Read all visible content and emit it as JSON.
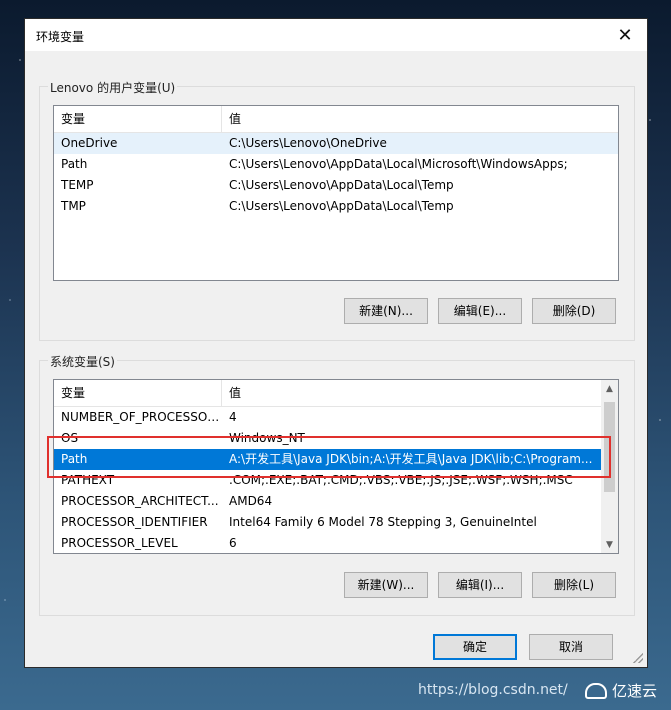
{
  "window": {
    "title": "环境变量",
    "close_glyph": "✕"
  },
  "user_vars": {
    "group_label": "Lenovo 的用户变量(U)",
    "columns": [
      "变量",
      "值"
    ],
    "rows": [
      {
        "name": "OneDrive",
        "value": "C:\\Users\\Lenovo\\OneDrive"
      },
      {
        "name": "Path",
        "value": "C:\\Users\\Lenovo\\AppData\\Local\\Microsoft\\WindowsApps;"
      },
      {
        "name": "TEMP",
        "value": "C:\\Users\\Lenovo\\AppData\\Local\\Temp"
      },
      {
        "name": "TMP",
        "value": "C:\\Users\\Lenovo\\AppData\\Local\\Temp"
      }
    ],
    "buttons": {
      "new": "新建(N)...",
      "edit": "编辑(E)...",
      "delete": "删除(D)"
    }
  },
  "system_vars": {
    "group_label": "系统变量(S)",
    "columns": [
      "变量",
      "值"
    ],
    "rows": [
      {
        "name": "NUMBER_OF_PROCESSORS",
        "value": "4"
      },
      {
        "name": "OS",
        "value": "Windows_NT"
      },
      {
        "name": "Path",
        "value": "A:\\开发工具\\Java JDK\\bin;A:\\开发工具\\Java JDK\\lib;C:\\Program..."
      },
      {
        "name": "PATHEXT",
        "value": ".COM;.EXE;.BAT;.CMD;.VBS;.VBE;.JS;.JSE;.WSF;.WSH;.MSC"
      },
      {
        "name": "PROCESSOR_ARCHITECT...",
        "value": "AMD64"
      },
      {
        "name": "PROCESSOR_IDENTIFIER",
        "value": "Intel64 Family 6 Model 78 Stepping 3, GenuineIntel"
      },
      {
        "name": "PROCESSOR_LEVEL",
        "value": "6"
      }
    ],
    "buttons": {
      "new": "新建(W)...",
      "edit": "编辑(I)...",
      "delete": "删除(L)"
    }
  },
  "footer": {
    "ok": "确定",
    "cancel": "取消"
  },
  "overlay": {
    "watermark": "https://blog.csdn.net/",
    "brand": "亿速云"
  },
  "colors": {
    "selection": "#0078d7",
    "highlight_box": "#e0302d"
  }
}
